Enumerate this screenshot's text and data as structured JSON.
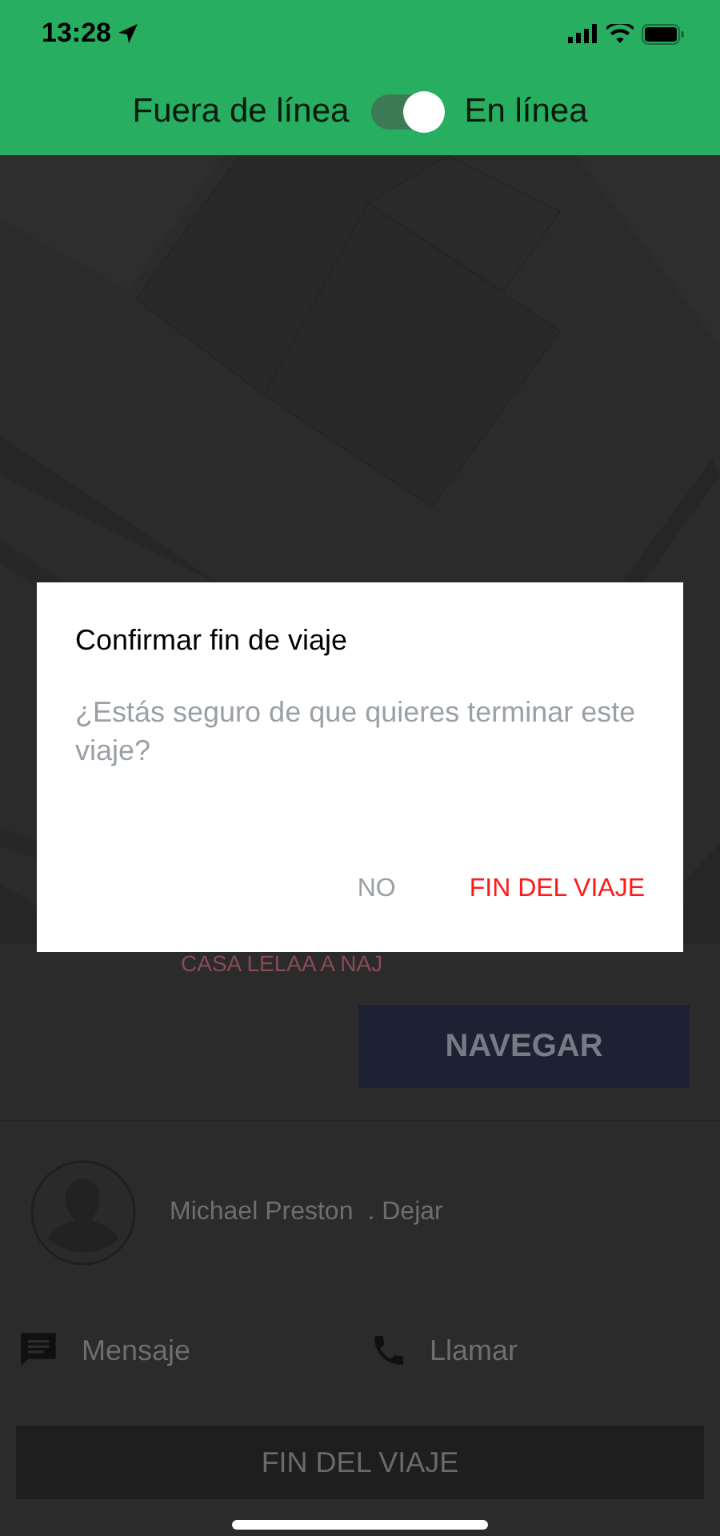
{
  "status_bar": {
    "time": "13:28"
  },
  "header": {
    "off_label": "Fuera de línea",
    "on_label": "En línea",
    "on": true
  },
  "trip": {
    "destination": "CASA LELAA A NAJ",
    "navigate_button": "NAVEGAR",
    "passenger": {
      "name": "Michael Preston",
      "action": ". Dejar"
    },
    "actions": [
      {
        "kind": "message",
        "label": "Mensaje"
      },
      {
        "kind": "call",
        "label": "Llamar"
      }
    ],
    "end_button": "FIN DEL VIAJE"
  },
  "dialog": {
    "title": "Confirmar fin de viaje",
    "message": "¿Estás seguro de que quieres terminar este viaje?",
    "buttons": [
      {
        "kind": "cancel",
        "label": "NO"
      },
      {
        "kind": "confirm",
        "label": "FIN DEL VIAJE"
      }
    ]
  }
}
